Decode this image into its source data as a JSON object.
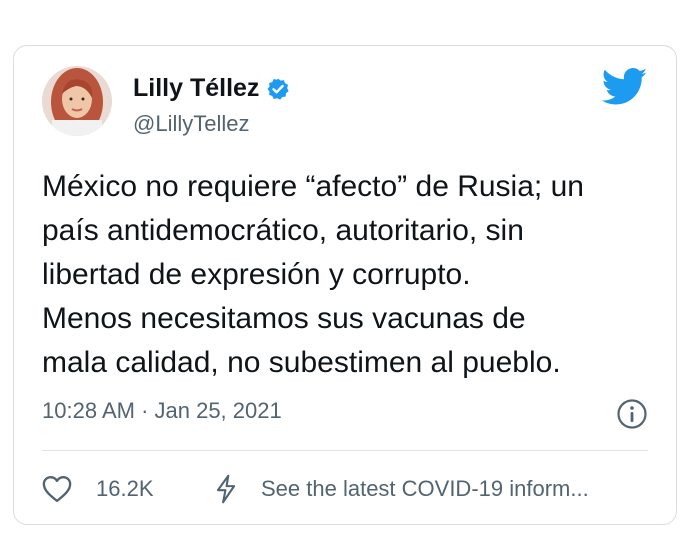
{
  "tweet": {
    "author_name": "Lilly Téllez",
    "handle": "@LillyTellez",
    "lines": [
      "México no requiere “afecto” de Rusia; un",
      "país antidemocrático, autoritario, sin",
      "libertad de expresión y corrupto.",
      "Menos necesitamos sus vacunas de",
      "mala calidad, no subestimen al pueblo."
    ],
    "timestamp": "10:28 AM · Jan 25, 2021",
    "likes": "16.2K",
    "covid_notice": "See the latest COVID-19 inform..."
  },
  "colors": {
    "twitter_blue": "#1d9bf0",
    "text": "#0f1419",
    "muted": "#536471"
  },
  "icons": [
    "verified-badge-icon",
    "twitter-bird-icon",
    "info-icon",
    "heart-icon",
    "bolt-icon"
  ]
}
